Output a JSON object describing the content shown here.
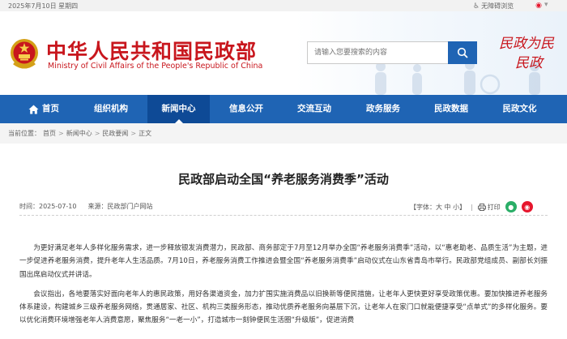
{
  "topbar": {
    "date": "2025年7月10日 星期四",
    "accessibility_label": "无障碍浏览"
  },
  "header": {
    "title_cn": "中华人民共和国民政部",
    "title_en": "Ministry of Civil Affairs of the People's Republic of China",
    "search_placeholder": "请输入您要搜索的内容",
    "slogan_line1": "民政为民",
    "slogan_line2": "民政"
  },
  "nav": {
    "items": [
      {
        "label": "首页"
      },
      {
        "label": "组织机构"
      },
      {
        "label": "新闻中心"
      },
      {
        "label": "信息公开"
      },
      {
        "label": "交流互动"
      },
      {
        "label": "政务服务"
      },
      {
        "label": "民政数据"
      },
      {
        "label": "民政文化"
      }
    ],
    "active_index": 2
  },
  "breadcrumb": {
    "prefix": "当前位置：",
    "items": [
      "首页",
      "新闻中心",
      "民政要闻",
      "正文"
    ],
    "separator": ">"
  },
  "article": {
    "title": "民政部启动全国“养老服务消费季”活动",
    "date": "时间：2025-07-10",
    "source": "来源：民政部门户网站",
    "font_size_label": "【字体：大  中  小】",
    "print_label": "打印",
    "paragraphs": [
      "为更好满足老年人多样化服务需求，进一步释放银发消费潜力，民政部、商务部定于7月至12月举办全国“养老服务消费季”活动，以“惠老助老、品质生活”为主题，进一步促进养老服务消费，提升老年人生活品质。7月10日，养老服务消费工作推进会暨全国“养老服务消费季”启动仪式在山东省青岛市举行。民政部党组成员、副部长刘振国出席启动仪式并讲话。",
      "会议指出，各地要落实好面向老年人的惠民政策，用好各渠道资金，加力扩围实施消费品以旧换新等便民措施，让老年人更快更好享受政策优惠。要加快推进养老服务体系建设，构建城乡三级养老服务网络，贯通居家、社区、机构三类服务形态，推动优质养老服务向基层下沉，让老年人在家门口就能便捷享受“点单式”的多样化服务。要以优化消费环境增强老年人消费意愿，聚焦服务“一老一小”，打造城市一刻钟便民生活圈“升级版”，促进消费"
    ]
  },
  "colors": {
    "brand_red": "#c8161d",
    "nav_blue": "#1f64b4",
    "nav_active": "#0e4a96"
  }
}
